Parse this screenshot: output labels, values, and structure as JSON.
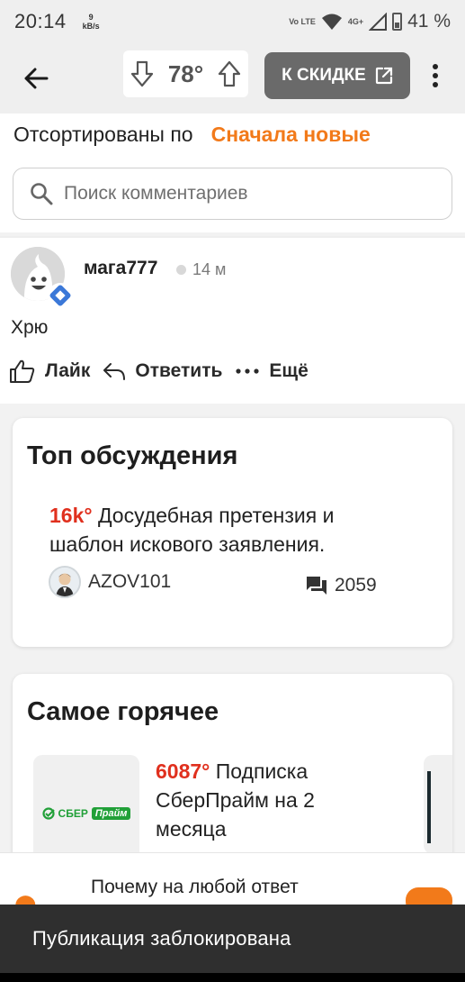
{
  "status_bar": {
    "time": "20:14",
    "net_speed_value": "9",
    "net_speed_unit": "kB/s",
    "volte": "Vo LTE",
    "network": "4G+",
    "battery": "41 %"
  },
  "app_bar": {
    "temperature": "78°",
    "deal_button_label": "К СКИДКЕ"
  },
  "sort": {
    "label": "Отсортированы по",
    "value": "Сначала новые"
  },
  "search": {
    "placeholder": "Поиск комментариев",
    "value": ""
  },
  "comment": {
    "author": "мага777",
    "time": "14 м",
    "text": "Хрю",
    "actions": {
      "like": "Лайк",
      "reply": "Ответить",
      "more": "Ещё"
    }
  },
  "top_discussions": {
    "title": "Топ обсуждения",
    "item": {
      "temperature": "16k°",
      "title": " Досудебная претензия и шаблон искового заявления.",
      "author": "AZOV101",
      "comments": "2059"
    }
  },
  "hottest": {
    "title": "Самое горячее",
    "item": {
      "temperature": "6087°",
      "title": " Подписка СберПрайм на 2 месяца",
      "logo_text": "СБЕР",
      "logo_badge": "Прайм"
    }
  },
  "ad": {
    "text": "Почему на любой ответ"
  },
  "snackbar": {
    "message": "Публикация заблокирована"
  },
  "colors": {
    "accent": "#f27a1a",
    "hot": "#e0301e",
    "button_grey": "#6a6a6a",
    "snackbar": "#2f2f2f"
  }
}
